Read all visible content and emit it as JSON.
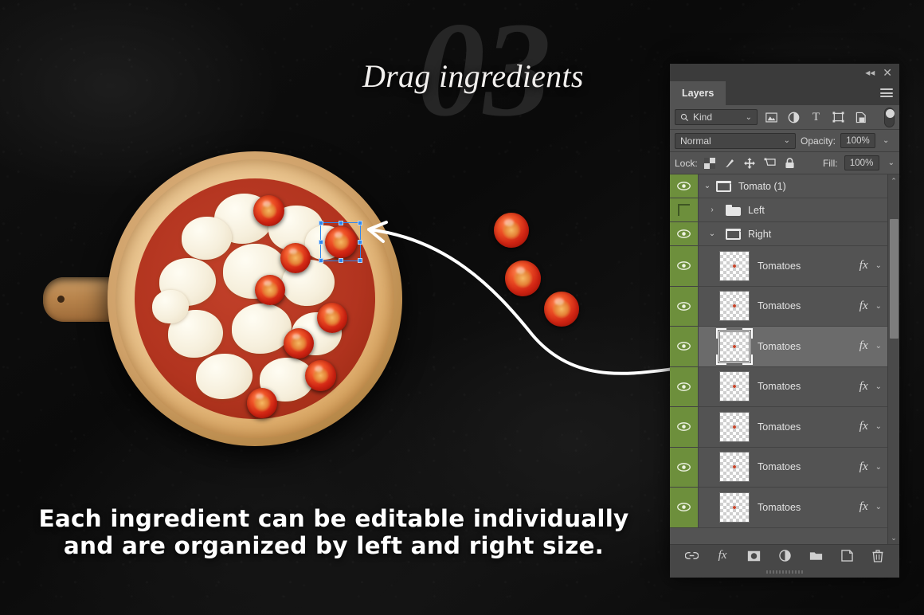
{
  "slide": {
    "step_number": "03",
    "headline": "Drag ingredients",
    "caption_line1": "Each ingredient can be editable individually",
    "caption_line2": "and are organized by left and right size."
  },
  "colors": {
    "background": "#0c0c0c",
    "visibility_green": "#6d8f3c",
    "panel_bg": "#474747",
    "row_bg": "#535353",
    "row_selected": "#6b6b6b",
    "selection_blue": "#2f87ef",
    "tomato_red": "#cf2413",
    "crust_tan": "#e8c088",
    "cheese_cream": "#f6efdc"
  },
  "panel": {
    "titlebar": {
      "collapse_icon": "double-left-chevron-icon",
      "close_icon": "close-icon",
      "close_glyph": "✕",
      "collapse_glyph": "◂◂"
    },
    "tab_label": "Layers",
    "menu_icon": "hamburger-menu-icon",
    "filter_row": {
      "search_icon": "search-icon",
      "kind_label": "Kind",
      "dropdown_caret": "⌄",
      "icons": [
        {
          "name": "pixel-layer-filter-icon",
          "title": "Pixel layers"
        },
        {
          "name": "adjustment-layer-filter-icon",
          "title": "Adjustment layers"
        },
        {
          "name": "type-layer-filter-icon",
          "title": "Type layers",
          "glyph": "T"
        },
        {
          "name": "shape-layer-filter-icon",
          "title": "Shape layers"
        },
        {
          "name": "smart-object-filter-icon",
          "title": "Smart objects"
        }
      ],
      "toggle_name": "filter-enable-toggle"
    },
    "blend_row": {
      "blend_mode": "Normal",
      "opacity_label": "Opacity:",
      "opacity_value": "100%"
    },
    "lock_row": {
      "lock_label": "Lock:",
      "fill_label": "Fill:",
      "fill_value": "100%",
      "lock_icons": [
        {
          "name": "lock-transparent-pixels-icon"
        },
        {
          "name": "lock-image-pixels-icon"
        },
        {
          "name": "lock-position-icon"
        },
        {
          "name": "lock-artboard-nesting-icon"
        },
        {
          "name": "lock-all-icon"
        }
      ]
    },
    "layers": [
      {
        "id": "grp-tomato",
        "type": "group",
        "name": "Tomato (1)",
        "visible": true,
        "expanded": true,
        "indent": 0,
        "selected": false
      },
      {
        "id": "grp-left",
        "type": "group",
        "name": "Left",
        "visible": false,
        "expanded": false,
        "indent": 1,
        "selected": false
      },
      {
        "id": "grp-right",
        "type": "group",
        "name": "Right",
        "visible": true,
        "expanded": true,
        "indent": 1,
        "selected": false
      },
      {
        "id": "lyr-1",
        "type": "layer",
        "name": "Tomatoes",
        "visible": true,
        "effects": "fx",
        "selected": false
      },
      {
        "id": "lyr-2",
        "type": "layer",
        "name": "Tomatoes",
        "visible": true,
        "effects": "fx",
        "selected": false
      },
      {
        "id": "lyr-3",
        "type": "layer",
        "name": "Tomatoes",
        "visible": true,
        "effects": "fx",
        "selected": true
      },
      {
        "id": "lyr-4",
        "type": "layer",
        "name": "Tomatoes",
        "visible": true,
        "effects": "fx",
        "selected": false
      },
      {
        "id": "lyr-5",
        "type": "layer",
        "name": "Tomatoes",
        "visible": true,
        "effects": "fx",
        "selected": false
      },
      {
        "id": "lyr-6",
        "type": "layer",
        "name": "Tomatoes",
        "visible": true,
        "effects": "fx",
        "selected": false
      },
      {
        "id": "lyr-7",
        "type": "layer",
        "name": "Tomatoes",
        "visible": true,
        "effects": "fx",
        "selected": false
      }
    ],
    "scrollbar": {
      "up_glyph": "⌃",
      "down_glyph": "⌄"
    },
    "bottom_bar": [
      {
        "name": "link-layers-icon",
        "title": "Link layers"
      },
      {
        "name": "layer-style-fx-icon",
        "title": "Add a layer style",
        "glyph": "fx"
      },
      {
        "name": "add-layer-mask-icon",
        "title": "Add layer mask"
      },
      {
        "name": "new-adjustment-layer-icon",
        "title": "Create new fill or adjustment layer"
      },
      {
        "name": "new-group-icon",
        "title": "Create a new group"
      },
      {
        "name": "new-layer-icon",
        "title": "Create a new layer"
      },
      {
        "name": "delete-layer-icon",
        "title": "Delete layer"
      }
    ]
  },
  "canvas": {
    "selection_box_name": "transform-selection-box",
    "drag_arrow_name": "drag-path-arrow",
    "pizza_name": "pizza-on-wooden-board",
    "loose_tomatoes_count": 3,
    "pizza_tomatoes_count": 8
  }
}
